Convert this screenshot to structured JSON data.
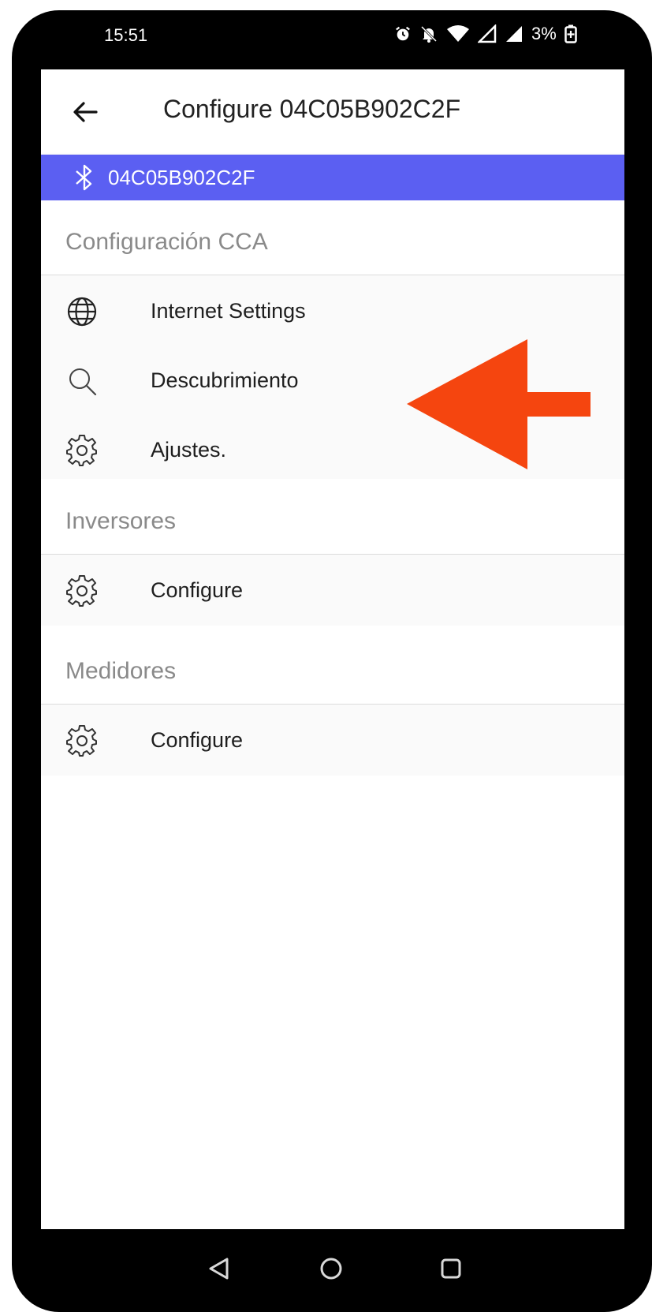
{
  "status_bar": {
    "time": "15:51",
    "battery": "3%",
    "icons": [
      "alarm-icon",
      "notifications-off-icon",
      "wifi-icon",
      "signal-icon",
      "signal-icon",
      "battery-charging-icon"
    ]
  },
  "app_bar": {
    "title": "Configure 04C05B902C2F",
    "back_icon": "arrow-left-icon"
  },
  "device_bar": {
    "icon": "bluetooth-icon",
    "label": "04C05B902C2F",
    "color": "#5b5ff2"
  },
  "sections": [
    {
      "header": "Configuración CCA",
      "items": [
        {
          "icon": "globe-icon",
          "label": "Internet Settings"
        },
        {
          "icon": "search-icon",
          "label": "Descubrimiento"
        },
        {
          "icon": "gear-icon",
          "label": "Ajustes."
        }
      ]
    },
    {
      "header": "Inversores",
      "items": [
        {
          "icon": "gear-icon",
          "label": "Configure"
        }
      ]
    },
    {
      "header": "Medidores",
      "items": [
        {
          "icon": "gear-icon",
          "label": "Configure"
        }
      ]
    }
  ],
  "annotation": {
    "arrow_color": "#f5450f",
    "points_to": "Descubrimiento"
  },
  "nav_bar": {
    "buttons": [
      "back-triangle-icon",
      "home-circle-icon",
      "recents-square-icon"
    ]
  }
}
